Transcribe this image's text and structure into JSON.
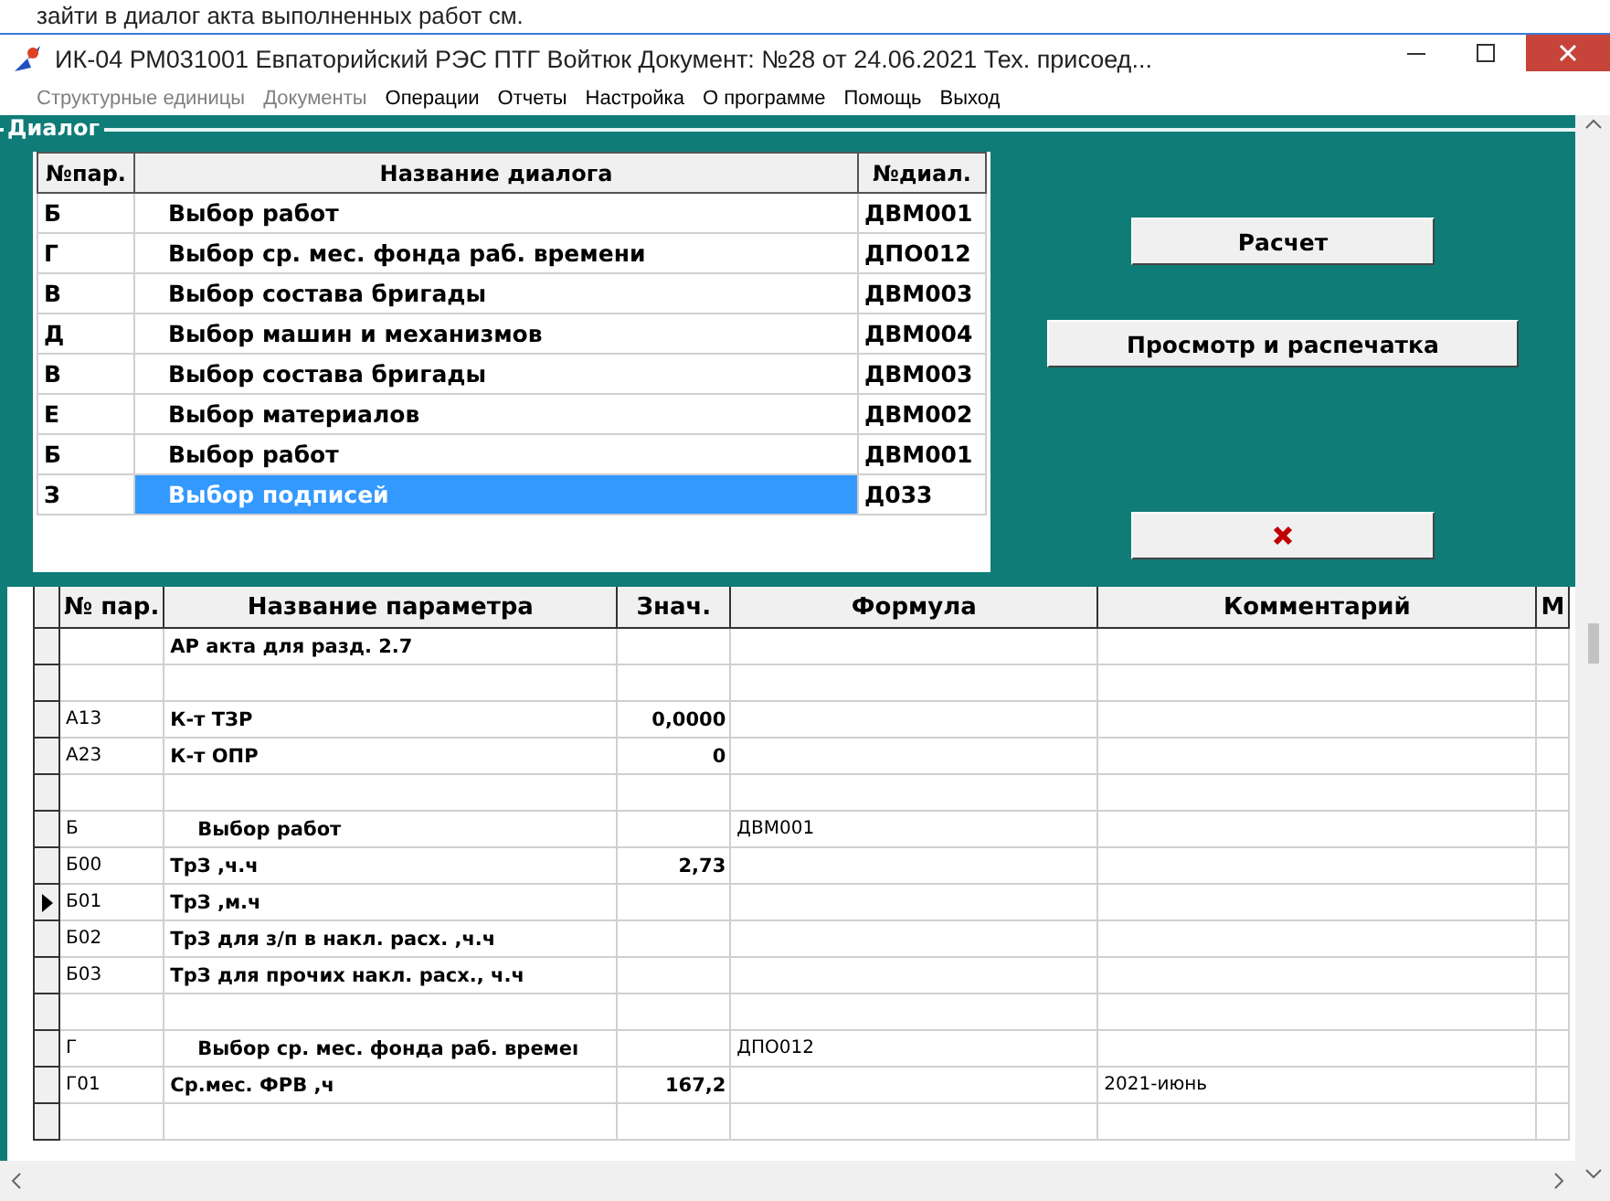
{
  "caption_above": "зайти в диалог акта выполненных работ см.",
  "window": {
    "title": "ИК-04 РМ031001 Евпаторийский РЭС ПТГ Войтюк Документ: №28 от 24.06.2021   Тех. присоед..."
  },
  "menu": [
    {
      "label": "Структурные единицы",
      "disabled": true
    },
    {
      "label": "Документы",
      "disabled": true
    },
    {
      "label": "Операции",
      "disabled": false
    },
    {
      "label": "Отчеты",
      "disabled": false
    },
    {
      "label": "Настройка",
      "disabled": false
    },
    {
      "label": "О программе",
      "disabled": false
    },
    {
      "label": "Помощь",
      "disabled": false
    },
    {
      "label": "Выход",
      "disabled": false
    }
  ],
  "dialog_group": {
    "title": "Диалог",
    "columns": [
      "№пар.",
      "Название диалога",
      "№диал."
    ],
    "rows": [
      {
        "par": "Б",
        "name": "Выбор работ",
        "dial": "ДВМ001",
        "selected": false
      },
      {
        "par": "Г",
        "name": "Выбор ср. мес. фонда раб. времени",
        "dial": "ДПО012",
        "selected": false
      },
      {
        "par": "В",
        "name": "Выбор состава бригады",
        "dial": "ДВМ003",
        "selected": false
      },
      {
        "par": "Д",
        "name": "Выбор машин и механизмов",
        "dial": "ДВМ004",
        "selected": false
      },
      {
        "par": "В",
        "name": "Выбор состава бригады",
        "dial": "ДВМ003",
        "selected": false
      },
      {
        "par": "Е",
        "name": "Выбор материалов",
        "dial": "ДВМ002",
        "selected": false
      },
      {
        "par": "Б",
        "name": "Выбор работ",
        "dial": "ДВМ001",
        "selected": false
      },
      {
        "par": "З",
        "name": "Выбор подписей",
        "dial": "Д033",
        "selected": true
      }
    ],
    "buttons": [
      {
        "kind": "text",
        "label": "Расчет"
      },
      {
        "kind": "text",
        "label": "Просмотр и распечатка"
      },
      {
        "kind": "cancel"
      }
    ]
  },
  "parameters": {
    "columns": [
      "№ пар.",
      "Название параметра",
      "Знач.",
      "Формула",
      "Комментарий",
      "М"
    ],
    "rows": [
      {
        "kind": "item",
        "par": "",
        "name": "АР акта для разд. 2.7",
        "value": "",
        "formula": "",
        "comment": "",
        "selected": false
      },
      {
        "kind": "item",
        "par": "",
        "name": "",
        "value": "",
        "formula": "",
        "comment": "",
        "selected": false
      },
      {
        "kind": "item",
        "par": "А13",
        "name": "К-т ТЗР",
        "value": "0,0000",
        "formula": "",
        "comment": "",
        "selected": false
      },
      {
        "kind": "item",
        "par": "А23",
        "name": "К-т ОПР",
        "value": "0",
        "formula": "",
        "comment": "",
        "selected": false
      },
      {
        "kind": "item",
        "par": "",
        "name": "",
        "value": "",
        "formula": "",
        "comment": "",
        "selected": false
      },
      {
        "kind": "section",
        "par": "Б",
        "name": "Выбор работ",
        "value": "",
        "formula": "ДВМ001",
        "comment": "",
        "selected": false
      },
      {
        "kind": "item",
        "par": "Б00",
        "name": "ТрЗ ,ч.ч",
        "value": "2,73",
        "formula": "",
        "comment": "",
        "selected": false
      },
      {
        "kind": "item",
        "par": "Б01",
        "name": "ТрЗ ,м.ч",
        "value": "",
        "formula": "",
        "comment": "",
        "selected": true
      },
      {
        "kind": "item",
        "par": "Б02",
        "name": "ТрЗ для з/п в накл. расх. ,ч.ч",
        "value": "",
        "formula": "",
        "comment": "",
        "selected": false
      },
      {
        "kind": "item",
        "par": "Б03",
        "name": "ТрЗ для прочих накл. расх., ч.ч",
        "value": "",
        "formula": "",
        "comment": "",
        "selected": false
      },
      {
        "kind": "item",
        "par": "",
        "name": "",
        "value": "",
        "formula": "",
        "comment": "",
        "selected": false
      },
      {
        "kind": "section",
        "par": "Г",
        "name": "Выбор ср. мес. фонда раб. времеı",
        "value": "",
        "formula": "ДПО012",
        "comment": "",
        "selected": false
      },
      {
        "kind": "item",
        "par": "Г01",
        "name": "Ср.мес. ФРВ ,ч",
        "value": "167,2",
        "formula": "",
        "comment": "2021-июнь",
        "selected": false
      },
      {
        "kind": "item",
        "par": "",
        "name": "",
        "value": "",
        "formula": "",
        "comment": "",
        "selected": false
      }
    ]
  }
}
